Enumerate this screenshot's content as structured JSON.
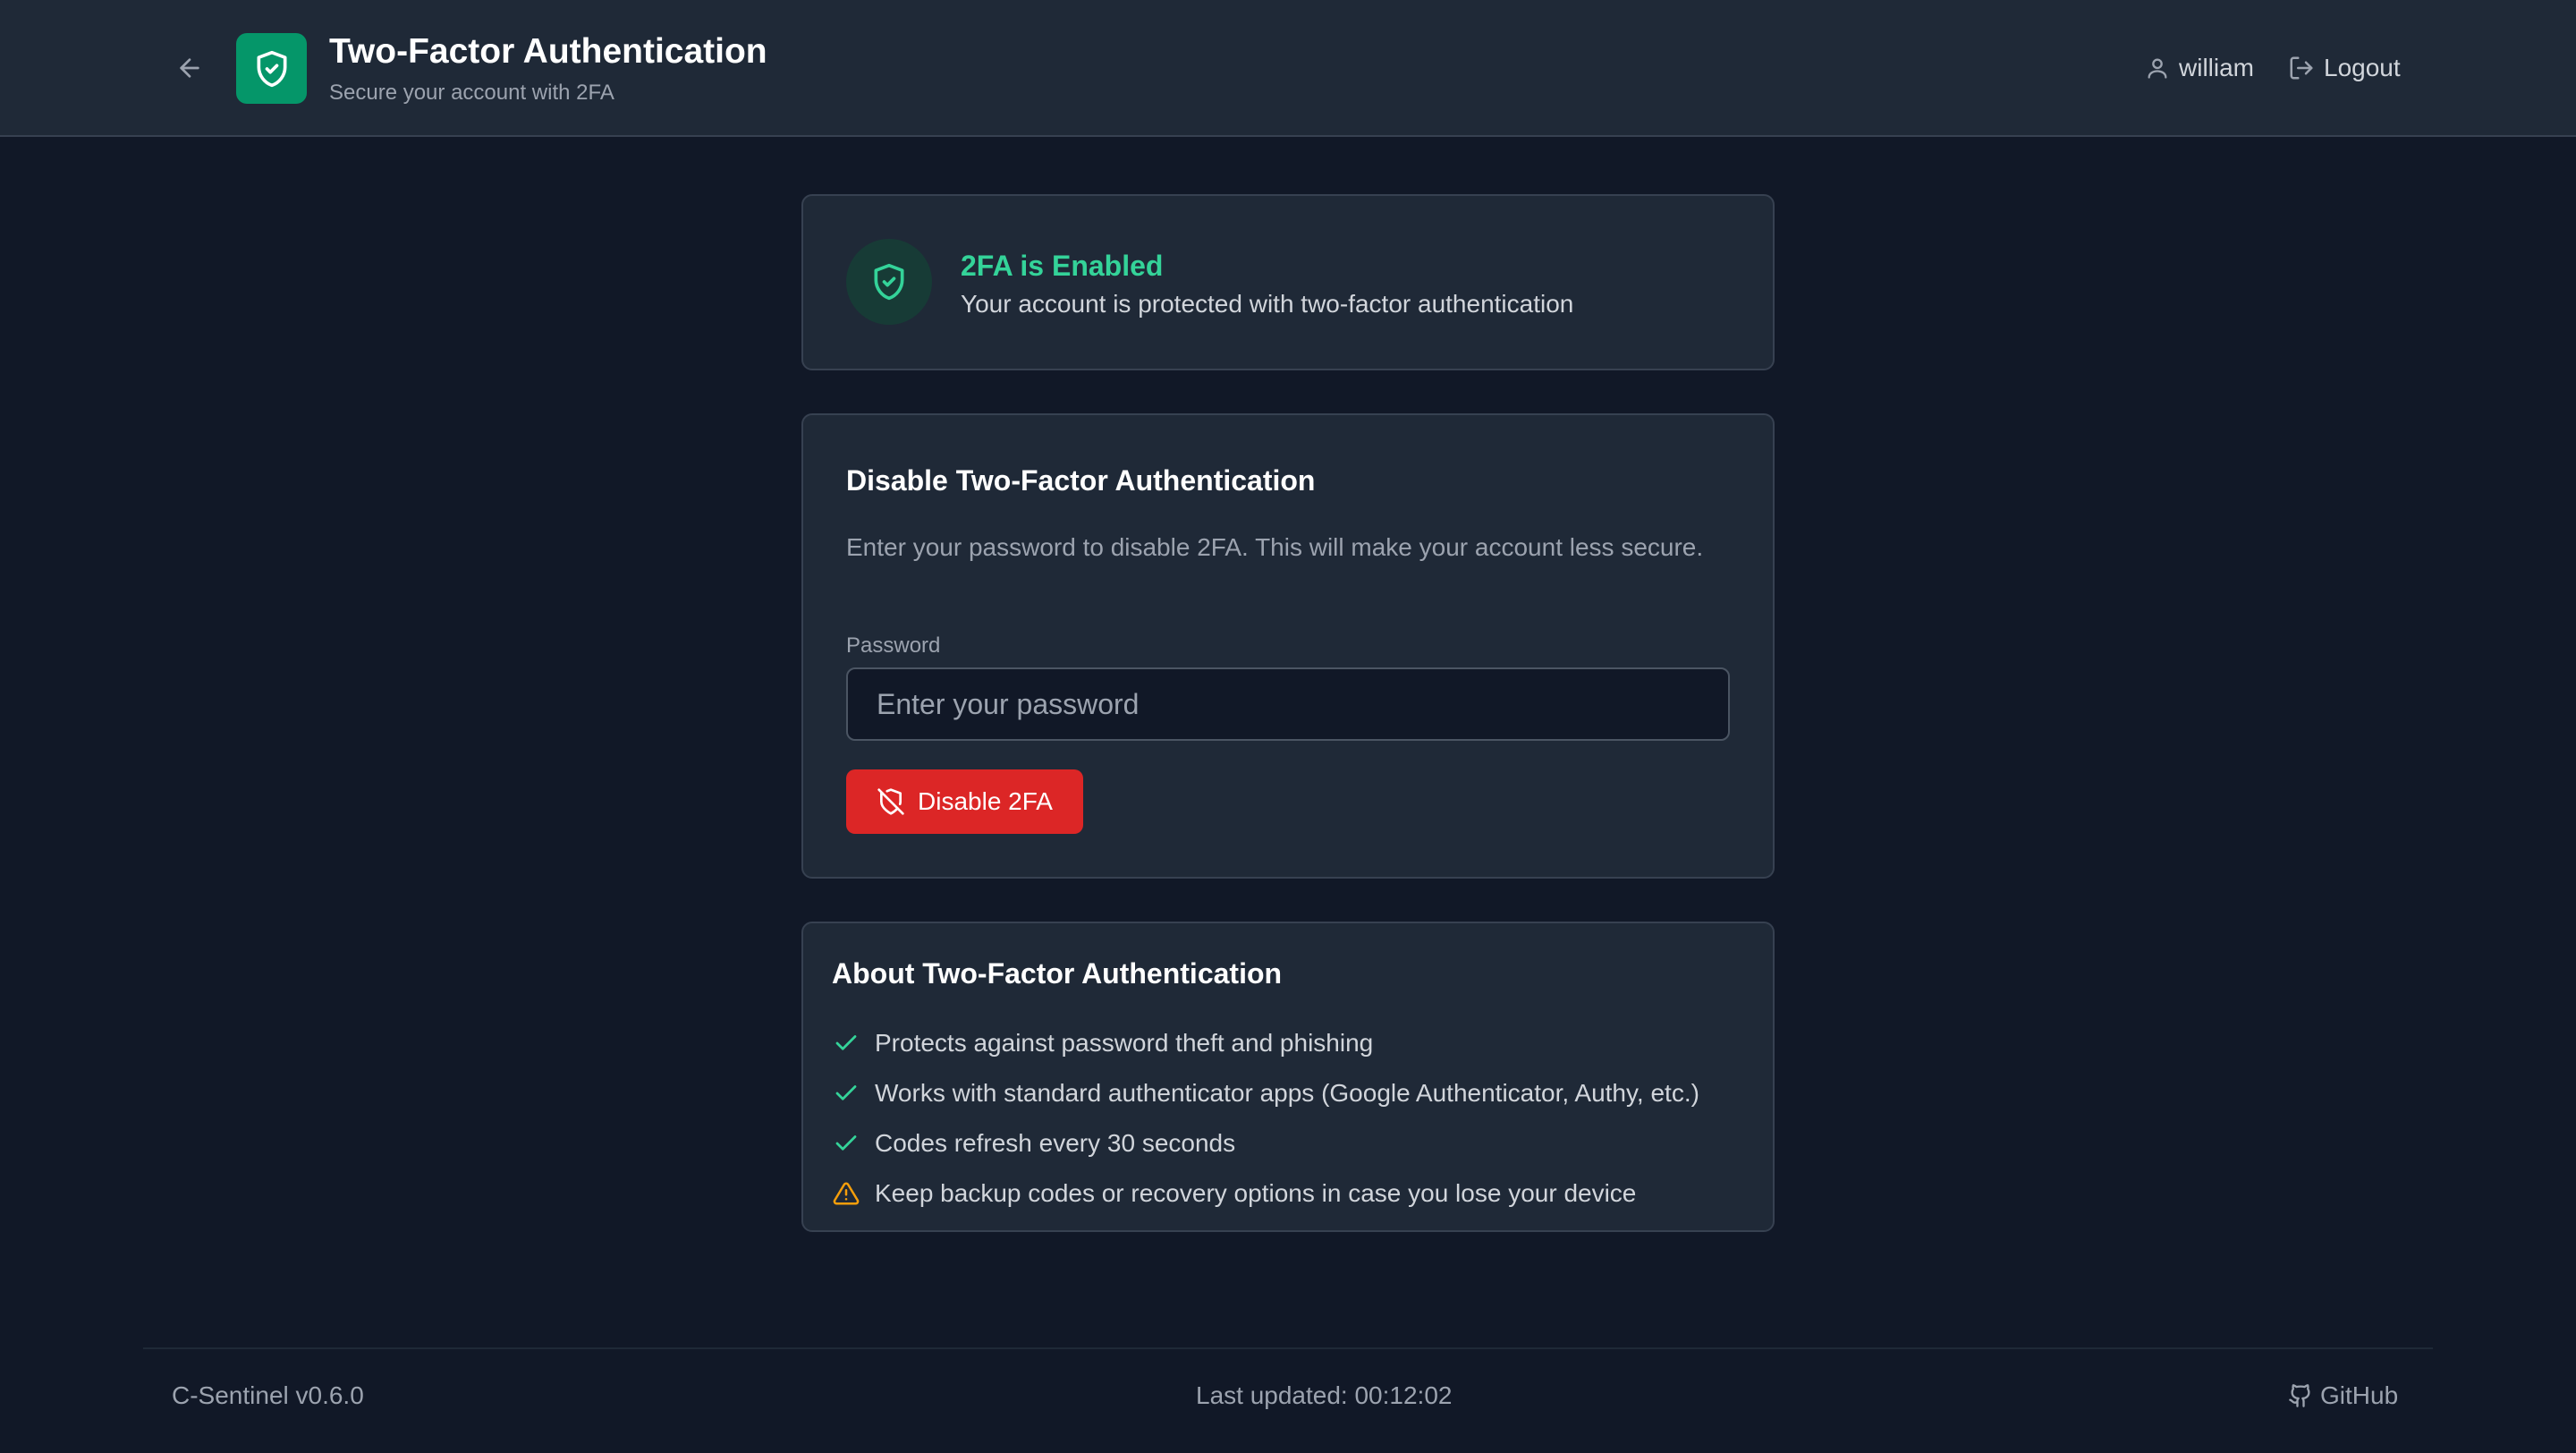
{
  "header": {
    "title": "Two-Factor Authentication",
    "subtitle": "Secure your account with 2FA",
    "username": "william",
    "logout_label": "Logout"
  },
  "status": {
    "title": "2FA is Enabled",
    "description": "Your account is protected with two-factor authentication"
  },
  "disable": {
    "title": "Disable Two-Factor Authentication",
    "description": "Enter your password to disable 2FA. This will make your account less secure.",
    "password_label": "Password",
    "password_placeholder": "Enter your password",
    "password_value": "",
    "button_label": "Disable 2FA"
  },
  "about": {
    "title": "About Two-Factor Authentication",
    "items": [
      {
        "text": "Protects against password theft and phishing",
        "icon": "check-icon"
      },
      {
        "text": "Works with standard authenticator apps (Google Authenticator, Authy, etc.)",
        "icon": "check-icon"
      },
      {
        "text": "Codes refresh every 30 seconds",
        "icon": "check-icon"
      },
      {
        "text": "Keep backup codes or recovery options in case you lose your device",
        "icon": "warning-icon"
      }
    ]
  },
  "footer": {
    "version": "C-Sentinel v0.6.0",
    "last_updated": "Last updated: 00:12:02",
    "github_label": "GitHub"
  },
  "colors": {
    "background": "#111827",
    "surface": "#1f2937",
    "accent_green": "#059669",
    "success_text": "#34d399",
    "danger": "#dc2626",
    "warning": "#f59e0b"
  }
}
